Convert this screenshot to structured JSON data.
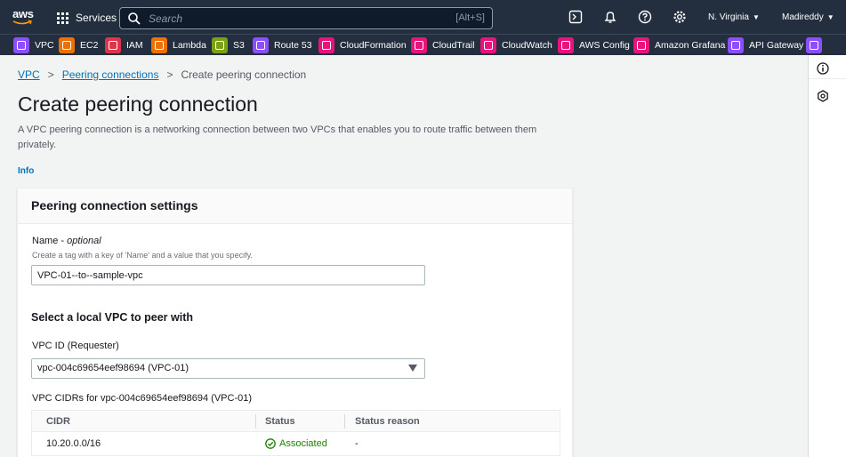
{
  "topnav": {
    "logo_text": "aws",
    "services_label": "Services",
    "search_placeholder": "Search",
    "search_shortcut": "[Alt+S]",
    "region_label": "N. Virginia",
    "user_label": "Madireddy"
  },
  "favorites": [
    {
      "label": "VPC",
      "color": "#8c4fff"
    },
    {
      "label": "EC2",
      "color": "#ed7100"
    },
    {
      "label": "IAM",
      "color": "#dd344c"
    },
    {
      "label": "Lambda",
      "color": "#ed7100"
    },
    {
      "label": "S3",
      "color": "#7aa116"
    },
    {
      "label": "Route 53",
      "color": "#8c4fff"
    },
    {
      "label": "CloudFormation",
      "color": "#e7157b"
    },
    {
      "label": "CloudTrail",
      "color": "#e7157b"
    },
    {
      "label": "CloudWatch",
      "color": "#e7157b"
    },
    {
      "label": "AWS Config",
      "color": "#e7157b"
    },
    {
      "label": "Amazon Grafana",
      "color": "#e7157b"
    },
    {
      "label": "API Gateway",
      "color": "#8c4fff"
    },
    {
      "label": "",
      "color": "#8c4fff"
    }
  ],
  "breadcrumb": {
    "root": "VPC",
    "parent": "Peering connections",
    "current": "Create peering connection"
  },
  "page": {
    "title": "Create peering connection",
    "description": "A VPC peering connection is a networking connection between two VPCs that enables you to route traffic between them privately.",
    "info_link": "Info"
  },
  "settings": {
    "header": "Peering connection settings",
    "name_label": "Name - ",
    "name_optional": "optional",
    "name_hint": "Create a tag with a key of 'Name' and a value that you specify.",
    "name_value": "VPC-01--to--sample-vpc",
    "local_vpc_title": "Select a local VPC to peer with",
    "vpc_id_label": "VPC ID (Requester)",
    "vpc_id_value": "vpc-004c69654eef98694 (VPC-01)",
    "cidrs_label": "VPC CIDRs for vpc-004c69654eef98694 (VPC-01)",
    "table": {
      "columns": [
        "CIDR",
        "Status",
        "Status reason"
      ],
      "rows": [
        {
          "cidr": "10.20.0.0/16",
          "status": "Associated",
          "reason": "-"
        }
      ]
    }
  },
  "colors": {
    "nav_bg": "#232f3e",
    "link": "#0073bb",
    "success": "#1d8102"
  }
}
